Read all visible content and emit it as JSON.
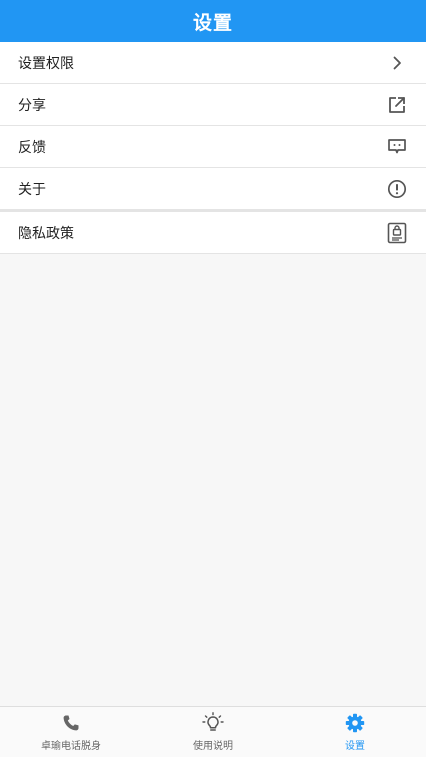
{
  "header": {
    "title": "设置"
  },
  "colors": {
    "accent": "#2196f3",
    "icon": "#555555",
    "tab_inactive": "#666666"
  },
  "settings": {
    "items": [
      {
        "label": "设置权限",
        "icon": "chevron-right-icon"
      },
      {
        "label": "分享",
        "icon": "share-icon"
      },
      {
        "label": "反馈",
        "icon": "feedback-icon"
      },
      {
        "label": "关于",
        "icon": "info-icon"
      },
      {
        "label": "隐私政策",
        "icon": "privacy-lock-icon"
      }
    ]
  },
  "tabbar": {
    "tabs": [
      {
        "label": "卓瑜电话脱身",
        "icon": "phone-icon",
        "active": false
      },
      {
        "label": "使用说明",
        "icon": "lightbulb-icon",
        "active": false
      },
      {
        "label": "设置",
        "icon": "gear-icon",
        "active": true
      }
    ]
  }
}
